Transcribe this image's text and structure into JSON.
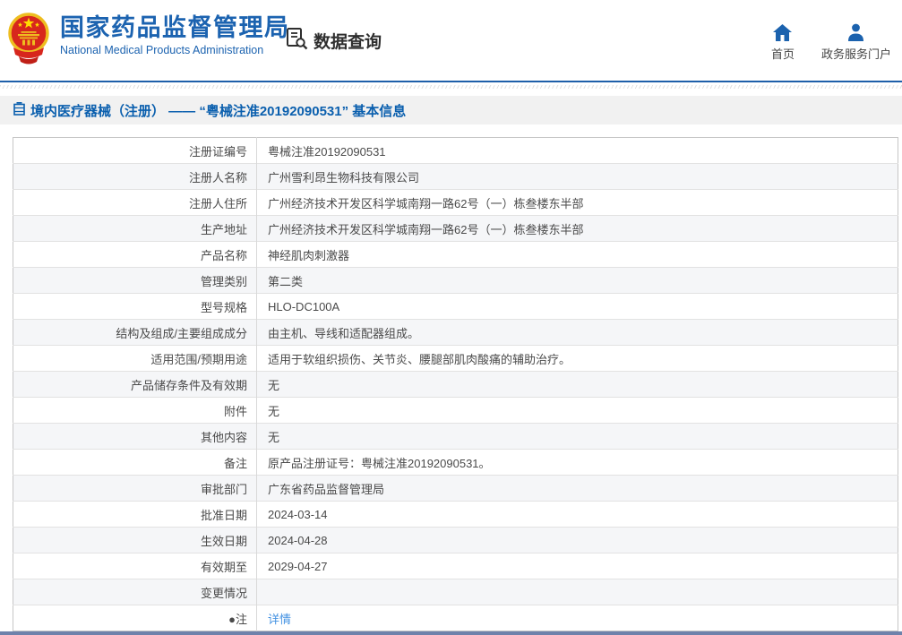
{
  "header": {
    "logo_title": "国家药品监督管理局",
    "logo_subtitle": "National Medical Products Administration",
    "query_label": "数据查询",
    "nav": [
      {
        "label": "首页"
      },
      {
        "label": "政务服务门户"
      }
    ]
  },
  "breadcrumb": {
    "title": "境内医疗器械（注册） —— “粤械注准20192090531” 基本信息"
  },
  "table": {
    "rows": [
      {
        "label": "注册证编号",
        "value": "粤械注准20192090531"
      },
      {
        "label": "注册人名称",
        "value": "广州雪利昂生物科技有限公司"
      },
      {
        "label": "注册人住所",
        "value": "广州经济技术开发区科学城南翔一路62号（一）栋叁楼东半部"
      },
      {
        "label": "生产地址",
        "value": "广州经济技术开发区科学城南翔一路62号（一）栋叁楼东半部"
      },
      {
        "label": "产品名称",
        "value": "神经肌肉刺激器"
      },
      {
        "label": "管理类别",
        "value": "第二类"
      },
      {
        "label": "型号规格",
        "value": "HLO-DC100A"
      },
      {
        "label": "结构及组成/主要组成成分",
        "value": "由主机、导线和适配器组成。"
      },
      {
        "label": "适用范围/预期用途",
        "value": "适用于软组织损伤、关节炎、腰腿部肌肉酸痛的辅助治疗。"
      },
      {
        "label": "产品储存条件及有效期",
        "value": "无"
      },
      {
        "label": "附件",
        "value": "无"
      },
      {
        "label": "其他内容",
        "value": "无"
      },
      {
        "label": "备注",
        "value": "原产品注册证号：粤械注准20192090531。"
      },
      {
        "label": "审批部门",
        "value": "广东省药品监督管理局"
      },
      {
        "label": "批准日期",
        "value": "2024-03-14"
      },
      {
        "label": "生效日期",
        "value": "2024-04-28"
      },
      {
        "label": "有效期至",
        "value": "2029-04-27"
      },
      {
        "label": "变更情况",
        "value": ""
      },
      {
        "label": "●注",
        "value": "详情",
        "link": true
      }
    ]
  },
  "colors": {
    "brand_blue": "#1c63b0",
    "divider_blue": "#1e5fa9",
    "title_bar_bg": "#f1f1f1",
    "title_text": "#0a5fae",
    "link_blue": "#4291e2",
    "footer_bar": "#6e82ab",
    "emblem_red": "#d7261d",
    "emblem_gold": "#eebd1f"
  }
}
